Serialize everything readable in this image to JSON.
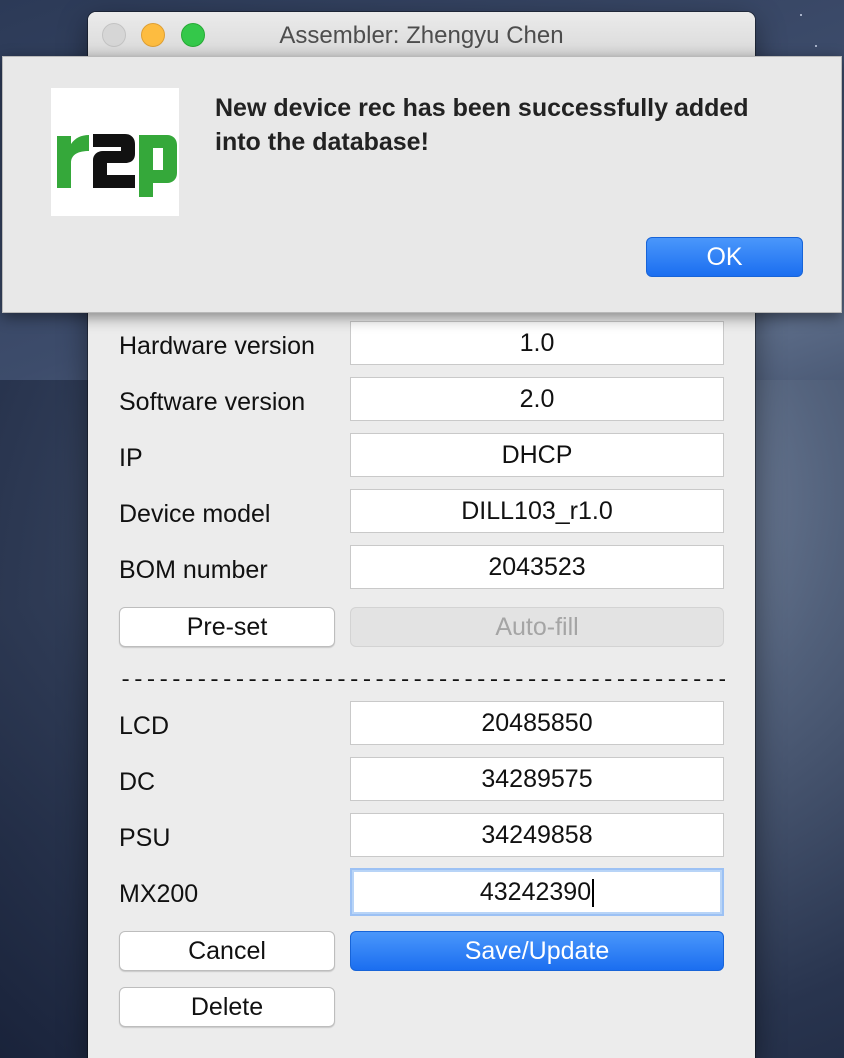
{
  "window": {
    "title": "Assembler: Zhengyu Chen"
  },
  "alert": {
    "logo_text": "r2p",
    "message": "New device rec has been successfully added into the database!",
    "ok_label": "OK"
  },
  "form": {
    "hardware_version": {
      "label": "Hardware version",
      "value": "1.0"
    },
    "software_version": {
      "label": "Software version",
      "value": "2.0"
    },
    "ip": {
      "label": "IP",
      "value": "DHCP"
    },
    "device_model": {
      "label": "Device model",
      "value": "DILL103_r1.0"
    },
    "bom_number": {
      "label": "BOM number",
      "value": "2043523"
    },
    "preset_label": "Pre-set",
    "autofill_label": "Auto-fill",
    "separator": "-------------------------------------------------------------",
    "lcd": {
      "label": "LCD",
      "value": "20485850"
    },
    "dc": {
      "label": "DC",
      "value": "34289575"
    },
    "psu": {
      "label": "PSU",
      "value": "34249858"
    },
    "mx200": {
      "label": "MX200",
      "value": "43242390"
    },
    "cancel_label": "Cancel",
    "save_label": "Save/Update",
    "delete_label": "Delete"
  },
  "colors": {
    "accent_blue": "#1b6ef0",
    "logo_green": "#35a83a",
    "logo_black": "#111111"
  }
}
